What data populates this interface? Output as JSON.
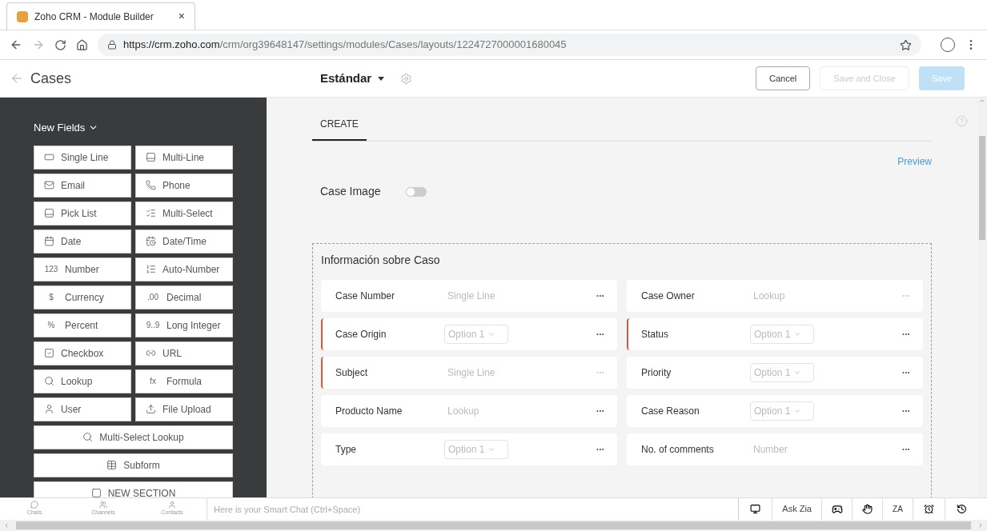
{
  "browser": {
    "tab_title": "Zoho CRM - Module Builder",
    "tab_close": "×",
    "url_host": "https://crm.zoho.com",
    "url_path": "/crm/org39648147/settings/modules/Cases/layouts/1224727000001680045"
  },
  "header": {
    "back_title": "Cases",
    "layout_name": "Estándar",
    "buttons": [
      {
        "label": "Cancel",
        "kind": "outline"
      },
      {
        "label": "Save and Close",
        "kind": "disabled"
      },
      {
        "label": "Save",
        "kind": "primary"
      }
    ]
  },
  "sidebar": {
    "title": "New Fields",
    "fields": [
      {
        "label": "Single Line",
        "kind": "half"
      },
      {
        "label": "Multi-Line",
        "kind": "half"
      },
      {
        "label": "Email",
        "kind": "half"
      },
      {
        "label": "Phone",
        "kind": "half"
      },
      {
        "label": "Pick List",
        "kind": "half"
      },
      {
        "label": "Multi-Select",
        "kind": "half"
      },
      {
        "label": "Date",
        "kind": "half"
      },
      {
        "label": "Date/Time",
        "kind": "half"
      },
      {
        "label": "Number",
        "kind": "half",
        "glyph": "123"
      },
      {
        "label": "Auto-Number",
        "kind": "half"
      },
      {
        "label": "Currency",
        "kind": "half",
        "glyph": "$"
      },
      {
        "label": "Decimal",
        "kind": "half",
        "glyph": ".00"
      },
      {
        "label": "Percent",
        "kind": "half",
        "glyph": "%"
      },
      {
        "label": "Long Integer",
        "kind": "half",
        "glyph": "9..9"
      },
      {
        "label": "Checkbox",
        "kind": "half"
      },
      {
        "label": "URL",
        "kind": "half"
      },
      {
        "label": "Lookup",
        "kind": "half"
      },
      {
        "label": "Formula",
        "kind": "half",
        "glyph": "fx"
      },
      {
        "label": "User",
        "kind": "half"
      },
      {
        "label": "File Upload",
        "kind": "half"
      },
      {
        "label": "Multi-Select Lookup",
        "kind": "full"
      },
      {
        "label": "Subform",
        "kind": "full"
      },
      {
        "label": "NEW SECTION",
        "kind": "full"
      }
    ]
  },
  "tabs": [
    {
      "label": "CREATE",
      "selected": true
    }
  ],
  "preview_link": "Preview",
  "case_image": {
    "label": "Case Image",
    "on": false
  },
  "section": {
    "title": "Información sobre Caso",
    "rows": [
      [
        {
          "label": "Case Number",
          "kind": "text",
          "type": "Single Line",
          "required": false,
          "dots": "···",
          "locked": false
        },
        {
          "label": "Case Owner",
          "kind": "text",
          "type": "Lookup",
          "required": false,
          "dots": "···",
          "locked": true
        }
      ],
      [
        {
          "label": "Case Origin",
          "kind": "select",
          "type": "Option 1",
          "required": true,
          "dots": "···",
          "locked": false
        },
        {
          "label": "Status",
          "kind": "select",
          "type": "Option 1",
          "required": true,
          "dots": "···",
          "locked": false
        }
      ],
      [
        {
          "label": "Subject",
          "kind": "text",
          "type": "Single Line",
          "required": true,
          "dots": "···",
          "locked": true
        },
        {
          "label": "Priority",
          "kind": "select",
          "type": "Option 1",
          "required": false,
          "dots": "···",
          "locked": false
        }
      ],
      [
        {
          "label": "Producto Name",
          "kind": "text",
          "type": "Lookup",
          "required": false,
          "dots": "···",
          "locked": false
        },
        {
          "label": "Case Reason",
          "kind": "select",
          "type": "Option 1",
          "required": false,
          "dots": "···",
          "locked": false
        }
      ],
      [
        {
          "label": "Type",
          "kind": "select",
          "type": "Option 1",
          "required": false,
          "dots": "···",
          "locked": false
        },
        {
          "label": "No. of comments",
          "kind": "text",
          "type": "Number",
          "required": false,
          "dots": "···",
          "locked": false
        }
      ]
    ]
  },
  "bottom_bar": {
    "shortcuts": [
      "Chats",
      "Channels",
      "Contacts"
    ],
    "chat_placeholder": "Here is your Smart Chat (Ctrl+Space)",
    "ask_zia": "Ask Zia",
    "tool_glyph": "ZA"
  }
}
